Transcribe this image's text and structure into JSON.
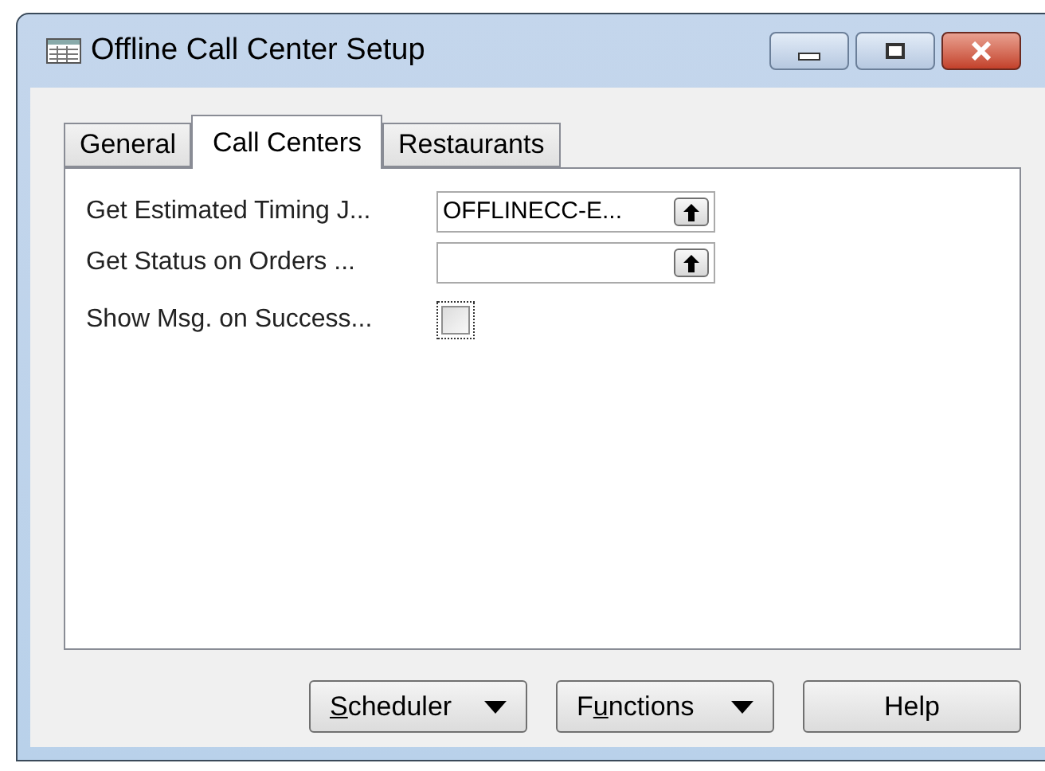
{
  "window": {
    "title": "Offline Call Center Setup"
  },
  "tabs": [
    {
      "label": "General",
      "selected": false
    },
    {
      "label": "Call Centers",
      "selected": true
    },
    {
      "label": "Restaurants",
      "selected": false
    }
  ],
  "fields": [
    {
      "kind": "lookup",
      "label": "Get Estimated Timing J...",
      "value": "OFFLINECC-E..."
    },
    {
      "kind": "lookup",
      "label": "Get Status on Orders ..."
    },
    {
      "kind": "checkbox",
      "label": "Show Msg. on Success...",
      "checked": false
    }
  ],
  "buttons": [
    {
      "kind": "menu",
      "mnemonic": "S",
      "mnemonic_suffix": "cheduler"
    },
    {
      "kind": "menu",
      "mnemonic_prefix": "F",
      "mnemonic": "u",
      "mnemonic_suffix": "nctions"
    },
    {
      "kind": "plain",
      "label": "Help"
    }
  ]
}
